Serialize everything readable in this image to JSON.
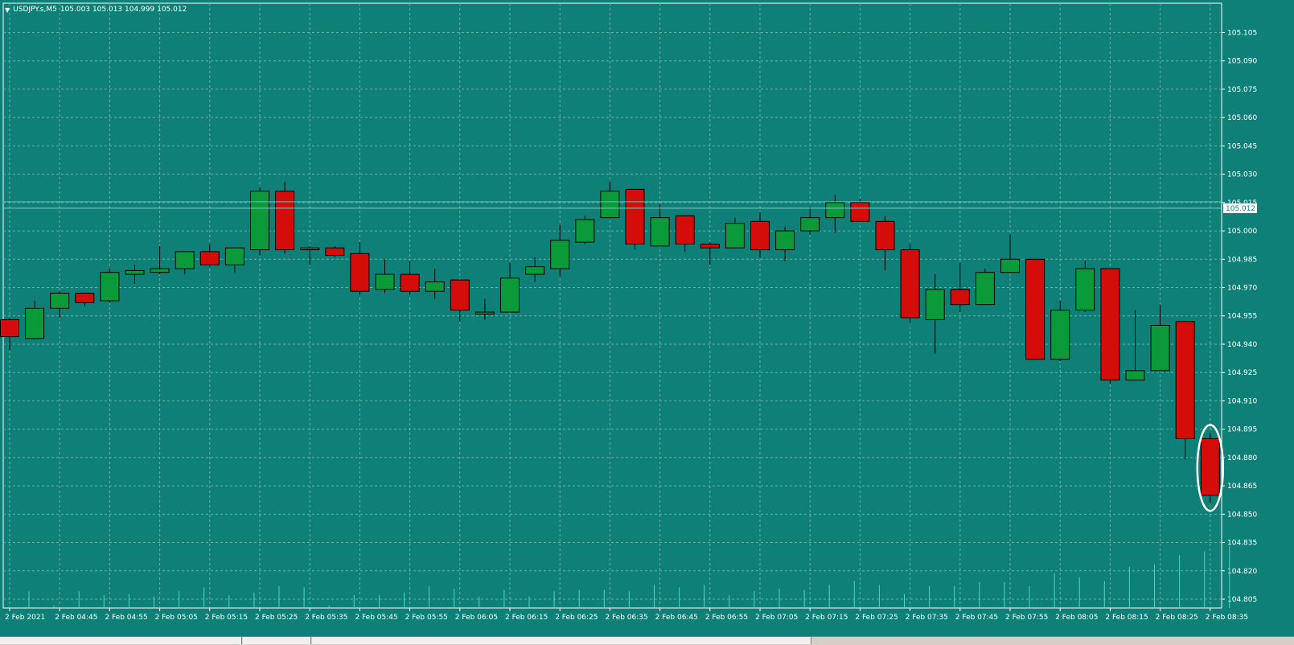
{
  "header": {
    "menu_icon": "triangle-down-icon",
    "symbol": "USDJPY.s,M5",
    "ohlc": "105.003 105.013 104.999 105.012"
  },
  "colors": {
    "background": "#0e8078",
    "bull": "#0a9a3a",
    "bear": "#d40d0a",
    "grid": "#5fb3ab",
    "text": "#ffffff",
    "highlight": "#ffffff"
  },
  "chart_data": {
    "type": "candlestick",
    "symbol": "USDJPY.s",
    "timeframe": "M5",
    "current_price": "105.012",
    "ylim": [
      104.805,
      105.115
    ],
    "y_ticks": [
      "105.105",
      "105.090",
      "105.075",
      "105.060",
      "105.045",
      "105.030",
      "105.015",
      "105.000",
      "104.985",
      "104.970",
      "104.955",
      "104.940",
      "104.925",
      "104.910",
      "104.895",
      "104.880",
      "104.865",
      "104.850",
      "104.835",
      "104.820",
      "104.805"
    ],
    "x_ticks": [
      "2 Feb 2021",
      "2 Feb 04:45",
      "2 Feb 04:55",
      "2 Feb 05:05",
      "2 Feb 05:15",
      "2 Feb 05:25",
      "2 Feb 05:35",
      "2 Feb 05:45",
      "2 Feb 05:55",
      "2 Feb 06:05",
      "2 Feb 06:15",
      "2 Feb 06:25",
      "2 Feb 06:35",
      "2 Feb 06:45",
      "2 Feb 06:55",
      "2 Feb 07:05",
      "2 Feb 07:15",
      "2 Feb 07:25",
      "2 Feb 07:35",
      "2 Feb 07:45",
      "2 Feb 07:55",
      "2 Feb 08:05",
      "2 Feb 08:15",
      "2 Feb 08:25",
      "2 Feb 08:35"
    ],
    "candles": [
      {
        "o": 104.953,
        "h": 104.954,
        "l": 104.937,
        "c": 104.944
      },
      {
        "o": 104.943,
        "h": 104.963,
        "l": 104.943,
        "c": 104.959
      },
      {
        "o": 104.959,
        "h": 104.968,
        "l": 104.954,
        "c": 104.967
      },
      {
        "o": 104.967,
        "h": 104.967,
        "l": 104.96,
        "c": 104.962
      },
      {
        "o": 104.963,
        "h": 104.98,
        "l": 104.962,
        "c": 104.978
      },
      {
        "o": 104.977,
        "h": 104.982,
        "l": 104.972,
        "c": 104.979
      },
      {
        "o": 104.978,
        "h": 104.992,
        "l": 104.977,
        "c": 104.98
      },
      {
        "o": 104.98,
        "h": 104.989,
        "l": 104.977,
        "c": 104.989
      },
      {
        "o": 104.989,
        "h": 104.993,
        "l": 104.981,
        "c": 104.982
      },
      {
        "o": 104.982,
        "h": 104.991,
        "l": 104.978,
        "c": 104.991
      },
      {
        "o": 104.99,
        "h": 105.023,
        "l": 104.987,
        "c": 105.021
      },
      {
        "o": 105.021,
        "h": 105.026,
        "l": 104.988,
        "c": 104.99
      },
      {
        "o": 104.99,
        "h": 104.992,
        "l": 104.982,
        "c": 104.991
      },
      {
        "o": 104.991,
        "h": 104.992,
        "l": 104.986,
        "c": 104.987
      },
      {
        "o": 104.988,
        "h": 104.994,
        "l": 104.966,
        "c": 104.968
      },
      {
        "o": 104.969,
        "h": 104.985,
        "l": 104.967,
        "c": 104.977
      },
      {
        "o": 104.977,
        "h": 104.984,
        "l": 104.966,
        "c": 104.968
      },
      {
        "o": 104.968,
        "h": 104.98,
        "l": 104.964,
        "c": 104.973
      },
      {
        "o": 104.974,
        "h": 104.974,
        "l": 104.952,
        "c": 104.958
      },
      {
        "o": 104.956,
        "h": 104.964,
        "l": 104.953,
        "c": 104.957
      },
      {
        "o": 104.957,
        "h": 104.983,
        "l": 104.957,
        "c": 104.975
      },
      {
        "o": 104.977,
        "h": 104.986,
        "l": 104.973,
        "c": 104.981
      },
      {
        "o": 104.98,
        "h": 105.003,
        "l": 104.976,
        "c": 104.995
      },
      {
        "o": 104.994,
        "h": 105.008,
        "l": 104.993,
        "c": 105.006
      },
      {
        "o": 105.007,
        "h": 105.026,
        "l": 105.007,
        "c": 105.021
      },
      {
        "o": 105.022,
        "h": 105.022,
        "l": 104.99,
        "c": 104.993
      },
      {
        "o": 104.992,
        "h": 105.014,
        "l": 104.992,
        "c": 105.007
      },
      {
        "o": 105.008,
        "h": 105.008,
        "l": 104.989,
        "c": 104.993
      },
      {
        "o": 104.993,
        "h": 104.994,
        "l": 104.982,
        "c": 104.991
      },
      {
        "o": 104.991,
        "h": 105.007,
        "l": 104.991,
        "c": 105.004
      },
      {
        "o": 105.005,
        "h": 105.01,
        "l": 104.986,
        "c": 104.99
      },
      {
        "o": 104.99,
        "h": 105.002,
        "l": 104.984,
        "c": 105.0
      },
      {
        "o": 105.0,
        "h": 105.013,
        "l": 104.998,
        "c": 105.007
      },
      {
        "o": 105.007,
        "h": 105.019,
        "l": 104.999,
        "c": 105.015
      },
      {
        "o": 105.015,
        "h": 105.017,
        "l": 105.005,
        "c": 105.005
      },
      {
        "o": 105.005,
        "h": 105.008,
        "l": 104.979,
        "c": 104.99
      },
      {
        "o": 104.99,
        "h": 104.993,
        "l": 104.951,
        "c": 104.954
      },
      {
        "o": 104.953,
        "h": 104.977,
        "l": 104.935,
        "c": 104.969
      },
      {
        "o": 104.969,
        "h": 104.983,
        "l": 104.957,
        "c": 104.961
      },
      {
        "o": 104.961,
        "h": 104.98,
        "l": 104.961,
        "c": 104.978
      },
      {
        "o": 104.978,
        "h": 104.998,
        "l": 104.978,
        "c": 104.985
      },
      {
        "o": 104.985,
        "h": 104.985,
        "l": 104.932,
        "c": 104.932
      },
      {
        "o": 104.932,
        "h": 104.963,
        "l": 104.931,
        "c": 104.958
      },
      {
        "o": 104.958,
        "h": 104.984,
        "l": 104.957,
        "c": 104.98
      },
      {
        "o": 104.98,
        "h": 104.98,
        "l": 104.919,
        "c": 104.921
      },
      {
        "o": 104.921,
        "h": 104.958,
        "l": 104.921,
        "c": 104.926
      },
      {
        "o": 104.926,
        "h": 104.961,
        "l": 104.926,
        "c": 104.95
      },
      {
        "o": 104.952,
        "h": 104.952,
        "l": 104.879,
        "c": 104.89
      },
      {
        "o": 104.89,
        "h": 104.893,
        "l": 104.856,
        "c": 104.86
      }
    ],
    "volume_ticks": [
      13,
      2,
      13,
      10,
      11,
      9,
      13,
      16,
      10,
      12,
      17,
      16,
      2,
      10,
      10,
      12,
      17,
      15,
      9,
      14,
      9,
      13,
      14,
      14,
      13,
      18,
      16,
      18,
      10,
      13,
      15,
      14,
      18,
      21,
      18,
      11,
      17,
      17,
      20,
      20,
      17,
      27,
      24,
      21,
      32,
      34,
      41,
      44,
      48
    ],
    "annotation": "highlight-last-candle"
  }
}
